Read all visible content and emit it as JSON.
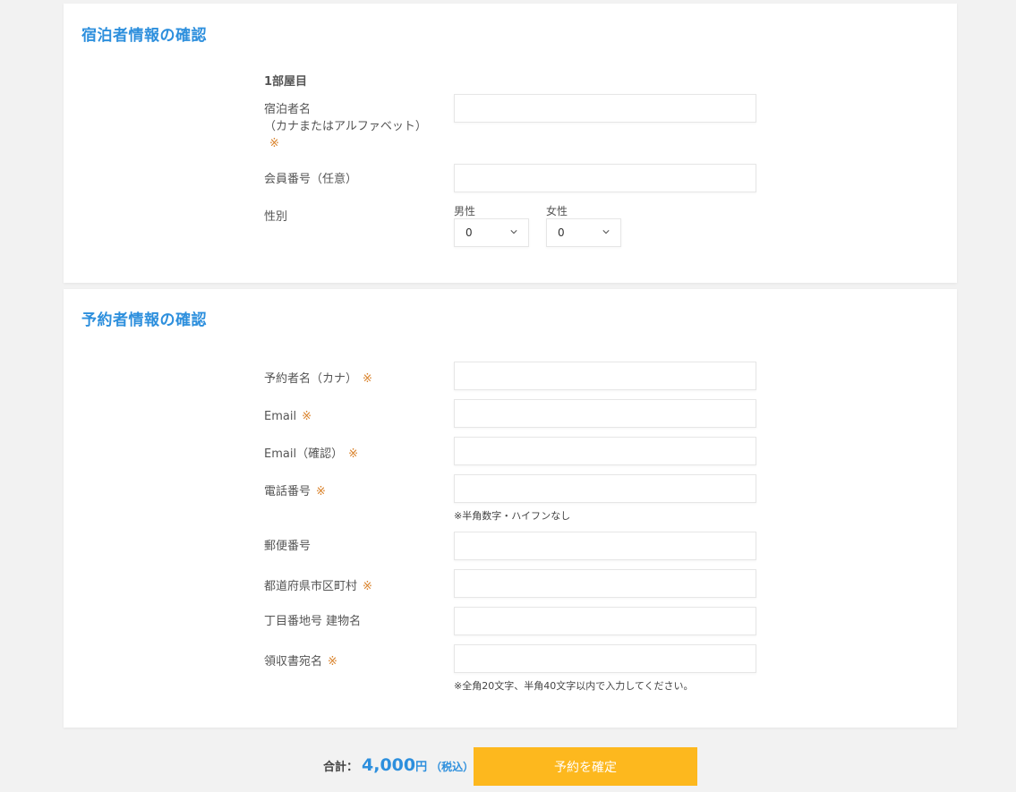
{
  "guest_section": {
    "title": "宿泊者情報の確認",
    "room_label": "1部屋目",
    "guest_name_label_line1": "宿泊者名",
    "guest_name_label_line2": "（カナまたはアルファベット）",
    "member_number_label": "会員番号（任意）",
    "gender_label": "性別",
    "male_label": "男性",
    "male_value": "0",
    "female_label": "女性",
    "female_value": "0"
  },
  "booker_section": {
    "title": "予約者情報の確認",
    "name_label": "予約者名（カナ）",
    "email_label": "Email",
    "email_confirm_label": "Email（確認）",
    "phone_label": "電話番号",
    "phone_note": "※半角数字・ハイフンなし",
    "postal_label": "郵便番号",
    "prefecture_label": "都道府県市区町村",
    "address_label": "丁目番地号 建物名",
    "receipt_label": "領収書宛名",
    "receipt_note": "※全角20文字、半角40文字以内で入力してください。"
  },
  "required_mark": "※",
  "footer": {
    "total_label": "合計：",
    "amount": "4,000",
    "yen": "円",
    "tax_note": "（税込）",
    "confirm_button": "予約を確定"
  },
  "colors": {
    "accent_blue": "#2d8fdd",
    "required_orange": "#d9822b",
    "button_yellow": "#fdb81e"
  }
}
